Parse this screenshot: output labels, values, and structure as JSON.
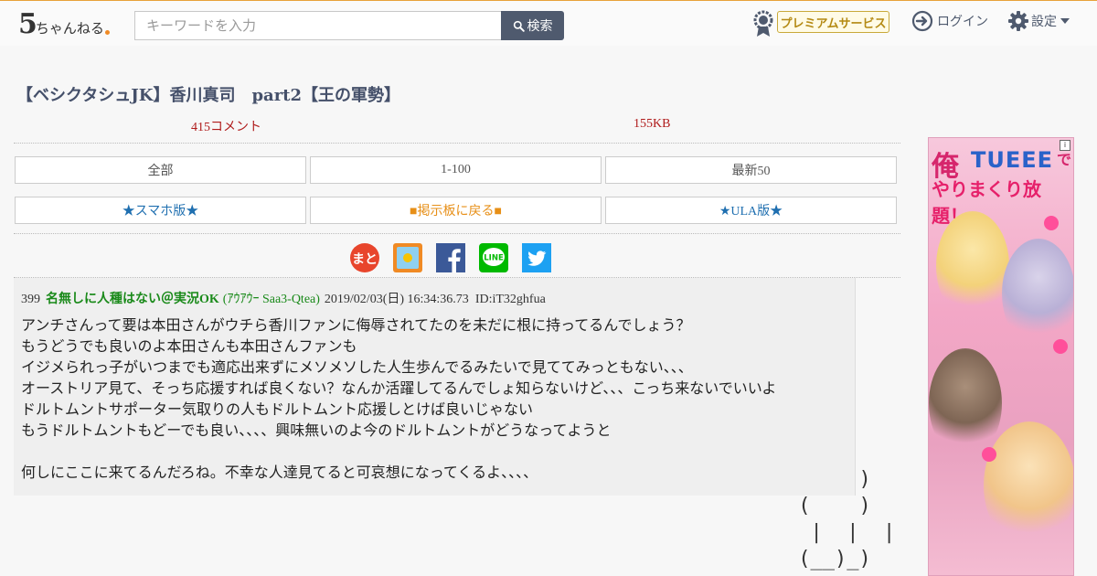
{
  "header": {
    "logo_main": "5",
    "logo_rest": "ちゃんねる",
    "search": {
      "placeholder": "キーワードを入力",
      "button_label": "検索"
    },
    "premium_label": "プレミアムサービス",
    "login_label": "ログイン",
    "settings_label": "設定"
  },
  "thread": {
    "title": "【ベシクタシュJK】香川真司　part2【王の軍勢】",
    "comment_count": "415コメント",
    "size": "155KB"
  },
  "nav": {
    "row1": [
      "全部",
      "1-100",
      "最新50"
    ],
    "row2": [
      "★スマホ版★",
      "■掲示板に戻る■",
      "★ULA版★"
    ]
  },
  "share_icons": [
    "matome-icon",
    "bookmark-icon",
    "facebook-icon",
    "line-icon",
    "twitter-icon"
  ],
  "share_labels": {
    "matome": "まと",
    "line": "LINE"
  },
  "post": {
    "number": "399",
    "name": "名無しに人種はない＠実況OK",
    "trip": "(ｱｳｱｳｰ Saa3-Qtea)",
    "date": "2019/02/03(日) 16:34:36.73",
    "id": "ID:iT32ghfua",
    "body": "アンチさんって要は本田さんがウチら香川ファンに侮辱されてたのを未だに根に持ってるんでしょう？\nもうどうでも良いのよ本田さんも本田さんファンも\nイジメられっ子がいつまでも適応出来ずにメソメソした人生歩んでるみたいで見ててみっともない、、、\nオーストリア見て、そっち応援すれば良くない？なんか活躍してるんでしょ知らないけど、、、こっち来ないでいいよ\nドルトムントサポーター気取りの人もドルトムント応援しとけば良いじゃない\nもうドルトムントもどーでも良い、、、、興味無いのよ今のドルトムントがどうなってようと\n\n何しにここに来てるんだろね。不幸な人達見てると可哀想になってくるよ、、、、"
  },
  "ad": {
    "line1_a": "俺",
    "line1_b": "TUEEE",
    "line1_c": "で",
    "line2": "やりまくり放題！",
    "close": "i"
  },
  "ascii_art": "      )\n (    )\n  |  |  |\n (__)_)"
}
